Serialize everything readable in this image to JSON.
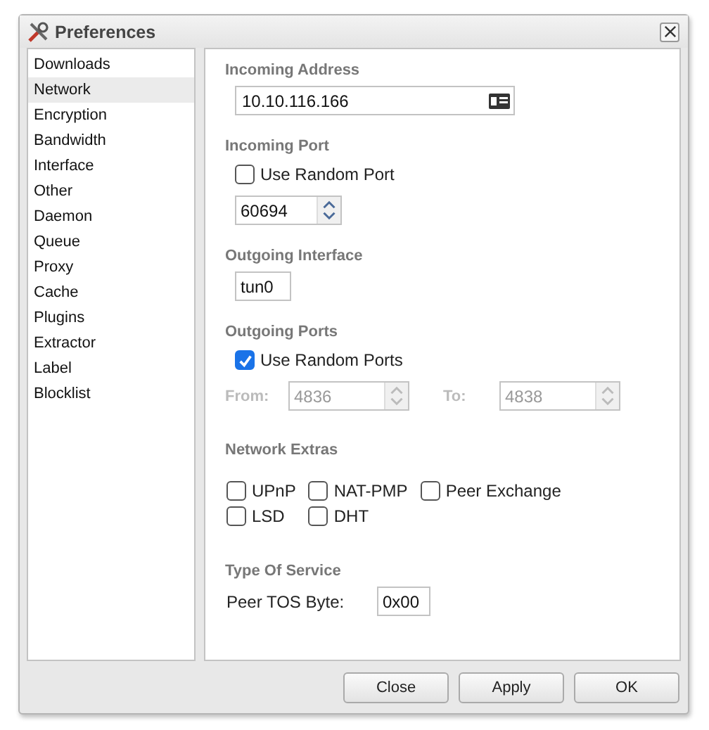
{
  "window": {
    "title": "Preferences"
  },
  "sidebar": {
    "items": [
      {
        "label": "Downloads",
        "selected": false
      },
      {
        "label": "Network",
        "selected": true
      },
      {
        "label": "Encryption",
        "selected": false
      },
      {
        "label": "Bandwidth",
        "selected": false
      },
      {
        "label": "Interface",
        "selected": false
      },
      {
        "label": "Other",
        "selected": false
      },
      {
        "label": "Daemon",
        "selected": false
      },
      {
        "label": "Queue",
        "selected": false
      },
      {
        "label": "Proxy",
        "selected": false
      },
      {
        "label": "Cache",
        "selected": false
      },
      {
        "label": "Plugins",
        "selected": false
      },
      {
        "label": "Extractor",
        "selected": false
      },
      {
        "label": "Label",
        "selected": false
      },
      {
        "label": "Blocklist",
        "selected": false
      }
    ]
  },
  "incoming_address": {
    "heading": "Incoming Address",
    "value": "10.10.116.166"
  },
  "incoming_port": {
    "heading": "Incoming Port",
    "random": {
      "label": "Use Random Port",
      "checked": false
    },
    "value": "60694"
  },
  "outgoing_interface": {
    "heading": "Outgoing Interface",
    "value": "tun0"
  },
  "outgoing_ports": {
    "heading": "Outgoing Ports",
    "random": {
      "label": "Use Random Ports",
      "checked": true
    },
    "from": {
      "label": "From:",
      "value": "4836",
      "disabled": true
    },
    "to": {
      "label": "To:",
      "value": "4838",
      "disabled": true
    }
  },
  "network_extras": {
    "heading": "Network Extras",
    "options": [
      {
        "label": "UPnP",
        "checked": false
      },
      {
        "label": "NAT-PMP",
        "checked": false
      },
      {
        "label": "Peer Exchange",
        "checked": false
      },
      {
        "label": "LSD",
        "checked": false
      },
      {
        "label": "DHT",
        "checked": false
      }
    ]
  },
  "type_of_service": {
    "heading": "Type Of Service",
    "label": "Peer TOS Byte:",
    "value": "0x00"
  },
  "buttons": [
    "Close",
    "Apply",
    "OK"
  ]
}
